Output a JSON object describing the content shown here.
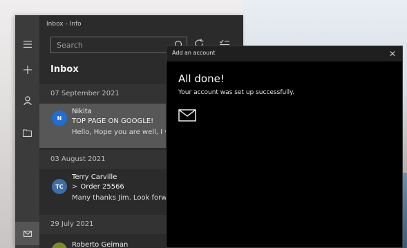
{
  "window": {
    "title": "Inbox - Info"
  },
  "rail": {
    "items": [
      {
        "icon": "hamburger-icon"
      },
      {
        "icon": "plus-icon"
      },
      {
        "icon": "person-icon"
      },
      {
        "icon": "folder-icon"
      },
      {
        "icon": "mail-icon"
      }
    ]
  },
  "search": {
    "placeholder": "Search"
  },
  "folder": {
    "title": "Inbox"
  },
  "groups": [
    {
      "date": "07 September 2021"
    },
    {
      "date": "03 August 2021"
    },
    {
      "date": "29 July 2021"
    }
  ],
  "mails": [
    {
      "initials": "N",
      "avatar_color": "#1f6ed4",
      "sender": "Nikita",
      "subject": "TOP PAGE ON GOOGLE!",
      "preview": "Hello, Hope you are well, I v"
    },
    {
      "initials": "TC",
      "avatar_color": "#3c6ea8",
      "sender": "Terry Carville",
      "subject": "Order 25566",
      "preview": "Many thanks Jim. Look forw"
    },
    {
      "initials": "",
      "avatar_color": "#7d8a2a",
      "sender": "Roberto Geiman",
      "subject": "",
      "preview": ""
    }
  ],
  "dialog": {
    "title": "Add an account",
    "heading": "All done!",
    "message": "Your account was set up successfully.",
    "close_label": "✕"
  }
}
